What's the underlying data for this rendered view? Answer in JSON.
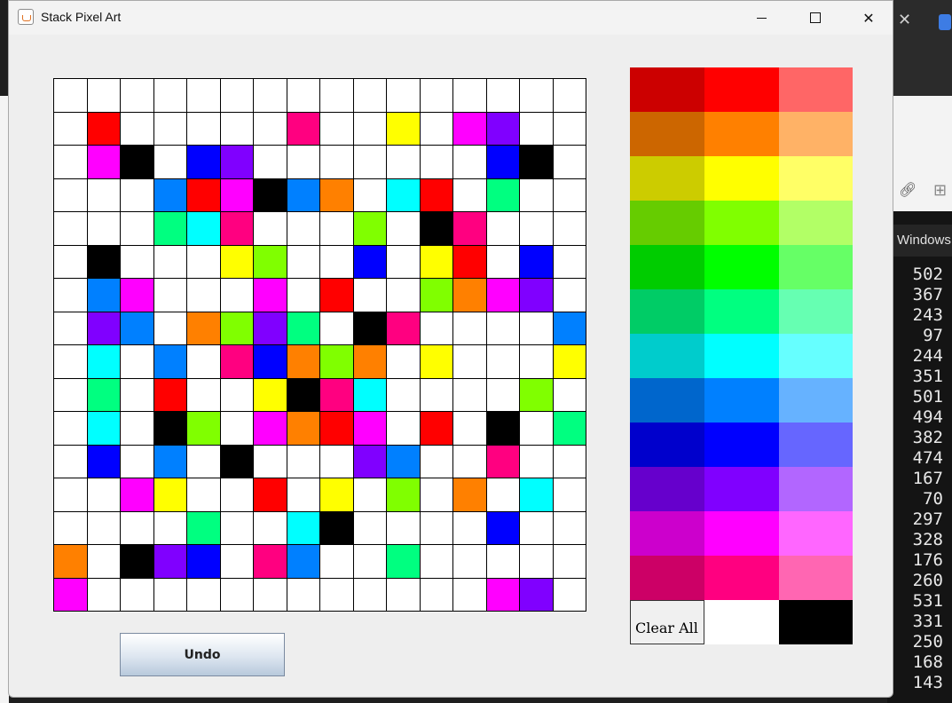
{
  "window": {
    "title": "Stack Pixel Art"
  },
  "undo_label": "Undo",
  "clear_all_label": "Clear All",
  "colors": {
    "W": "#ffffff",
    "K": "#000000",
    "R": "#ff0000",
    "O": "#ff8000",
    "Y": "#ffff00",
    "L": "#80ff00",
    "G": "#00ff80",
    "C": "#00ffff",
    "A": "#0080ff",
    "B": "#0000ff",
    "V": "#8000ff",
    "M": "#ff00ff",
    "P": "#ff0080"
  },
  "grid_rows": [
    "WWWWWWWWWWWWWWWW",
    "WRWWWWWPWWYWMVWW",
    "WMKWBVWWWWWWWBKW",
    "WWWARMKAOWCRWGWW",
    "WWWGCPWWWLWKPWWW",
    "WKWWWYLWWBWYRWBW",
    "WAMWWWMWRWWLOMVW",
    "WVAWOLVGWKPWWWWA",
    "WCWAWPBOLOWYWWWY",
    "WGWRWWYKPCWWWWLW",
    "WCWKLWMORMWRWKWG",
    "WBWAWKWWWVAWWPWW",
    "WWMYWWRWYWLWOWCW",
    "WWWWGWWCKWWWWBWW",
    "OWKVBWPAWWGWWWWW",
    "MWWWWWWWWWWWWMVW"
  ],
  "palette_rows": [
    [
      "#cc0000",
      "#ff0000",
      "#ff6666"
    ],
    [
      "#cc6600",
      "#ff8000",
      "#ffb266"
    ],
    [
      "#cccc00",
      "#ffff00",
      "#ffff66"
    ],
    [
      "#66cc00",
      "#80ff00",
      "#b2ff66"
    ],
    [
      "#00cc00",
      "#00ff00",
      "#66ff66"
    ],
    [
      "#00cc66",
      "#00ff80",
      "#66ffb2"
    ],
    [
      "#00cccc",
      "#00ffff",
      "#66ffff"
    ],
    [
      "#0066cc",
      "#0080ff",
      "#66b2ff"
    ],
    [
      "#0000cc",
      "#0000ff",
      "#6666ff"
    ],
    [
      "#6600cc",
      "#8000ff",
      "#b266ff"
    ],
    [
      "#cc00cc",
      "#ff00ff",
      "#ff66ff"
    ],
    [
      "#cc0066",
      "#ff0080",
      "#ff66b2"
    ]
  ],
  "palette_bottom": [
    "#ffffff",
    "#000000"
  ],
  "background": {
    "tab_label": "Windows",
    "numbers": [
      "502",
      "367",
      "243",
      "97",
      "244",
      "351",
      "501",
      "494",
      "382",
      "474",
      "167",
      "70",
      "297",
      "328",
      "176",
      "260",
      "531",
      "331",
      "250",
      "168",
      "143"
    ]
  }
}
